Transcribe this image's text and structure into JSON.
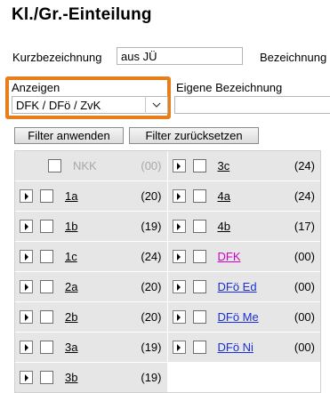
{
  "title": "Kl./Gr.-Einteilung",
  "kurz": {
    "label": "Kurzbezeichnung",
    "value": "aus JÜ"
  },
  "bezeichnung_label": "Bezeichnung",
  "anzeigen": {
    "label": "Anzeigen",
    "selected": "DFK / DFö / ZvK"
  },
  "eigene_label": "Eigene Bezeichnung",
  "buttons": {
    "apply": "Filter anwenden",
    "reset": "Filter zurücksetzen"
  },
  "colors": {
    "highlight": "#e87e1a",
    "dfk": "#d100c8",
    "dfo": "#1a2fd6",
    "disabled": "#a8a8a8"
  },
  "groups": {
    "r0": {
      "l": {
        "name": "NKK",
        "count": "(00)"
      },
      "r": {
        "name": "3c",
        "count": "(24)"
      }
    },
    "r1": {
      "l": {
        "name": "1a",
        "count": "(20)"
      },
      "r": {
        "name": "4a",
        "count": "(24)"
      }
    },
    "r2": {
      "l": {
        "name": "1b",
        "count": "(19)"
      },
      "r": {
        "name": "4b",
        "count": "(17)"
      }
    },
    "r3": {
      "l": {
        "name": "1c",
        "count": "(24)"
      },
      "r": {
        "name": "DFK",
        "count": "(00)"
      }
    },
    "r4": {
      "l": {
        "name": "2a",
        "count": "(20)"
      },
      "r": {
        "name": "DFö Ed",
        "count": "(00)"
      }
    },
    "r5": {
      "l": {
        "name": "2b",
        "count": "(20)"
      },
      "r": {
        "name": "DFö Me",
        "count": "(00)"
      }
    },
    "r6": {
      "l": {
        "name": "3a",
        "count": "(19)"
      },
      "r": {
        "name": "DFö Ni",
        "count": "(00)"
      }
    },
    "r7": {
      "l": {
        "name": "3b",
        "count": "(19)"
      }
    }
  }
}
